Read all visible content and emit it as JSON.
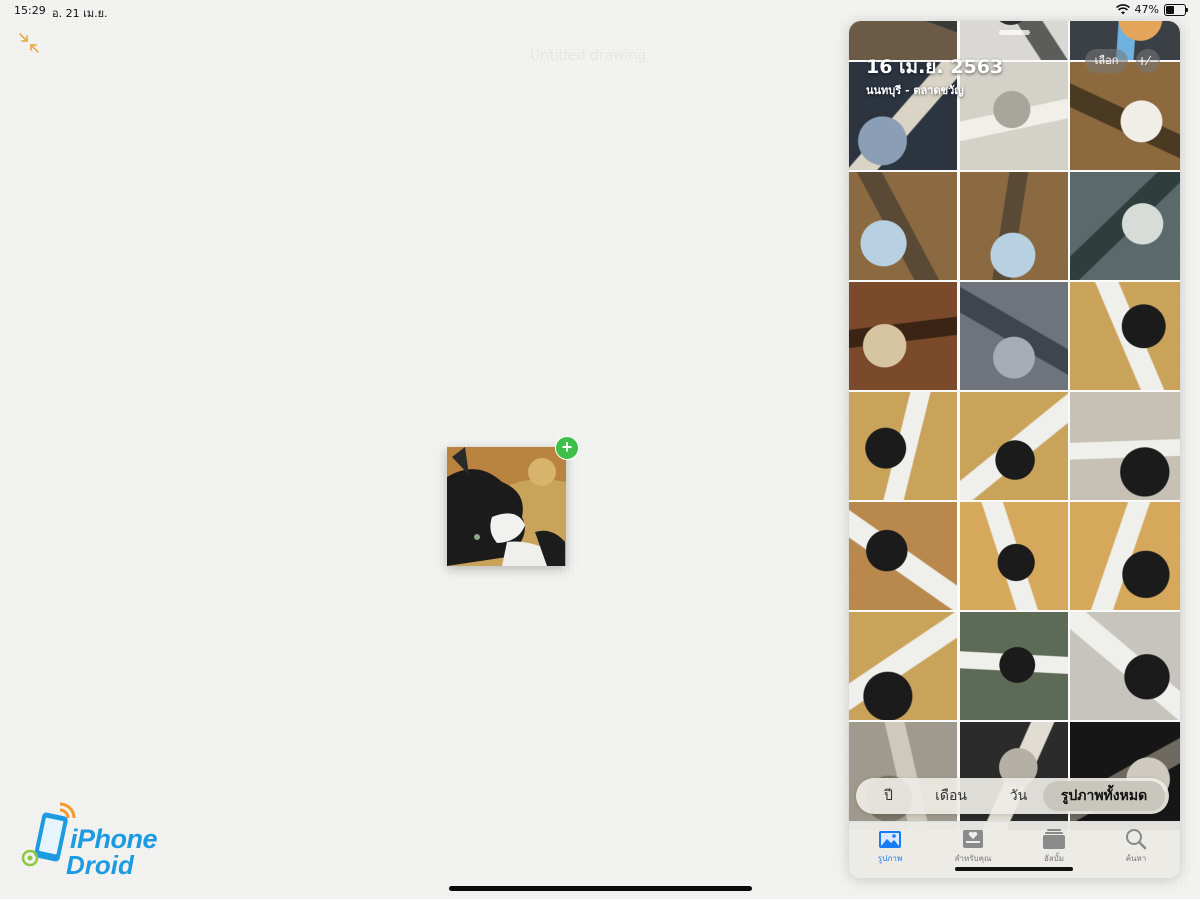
{
  "status": {
    "time": "15:29",
    "date": "อ. 21 เม.ย.",
    "battery": "47%",
    "battery_level": 0.47
  },
  "canvas": {
    "ghost_title": "Untitled drawing"
  },
  "photos_panel": {
    "date": "16 เม.ย. 2563",
    "location": "นนทบุรี - ตลาดขวัญ",
    "select_label": "เลือก",
    "zoom_label": "+⁄−",
    "segments": [
      "ปี",
      "เดือน",
      "วัน",
      "รูปภาพทั้งหมด"
    ],
    "active_segment": "รูปภาพทั้งหมด",
    "tabs": [
      {
        "label": "รูปภาพ",
        "icon": "photos-icon",
        "active": true
      },
      {
        "label": "สำหรับคุณ",
        "icon": "for-you-icon",
        "active": false
      },
      {
        "label": "อัลบั้ม",
        "icon": "albums-icon",
        "active": false
      },
      {
        "label": "ค้นหา",
        "icon": "search-icon",
        "active": false
      }
    ]
  },
  "logo": {
    "line1": "iPhone",
    "line2": "Droid"
  },
  "colors": {
    "accent": "#1a7cf5",
    "collapse_icon": "#e8a33a",
    "add_badge": "#3cc04a",
    "logo": "#1d9be0"
  }
}
